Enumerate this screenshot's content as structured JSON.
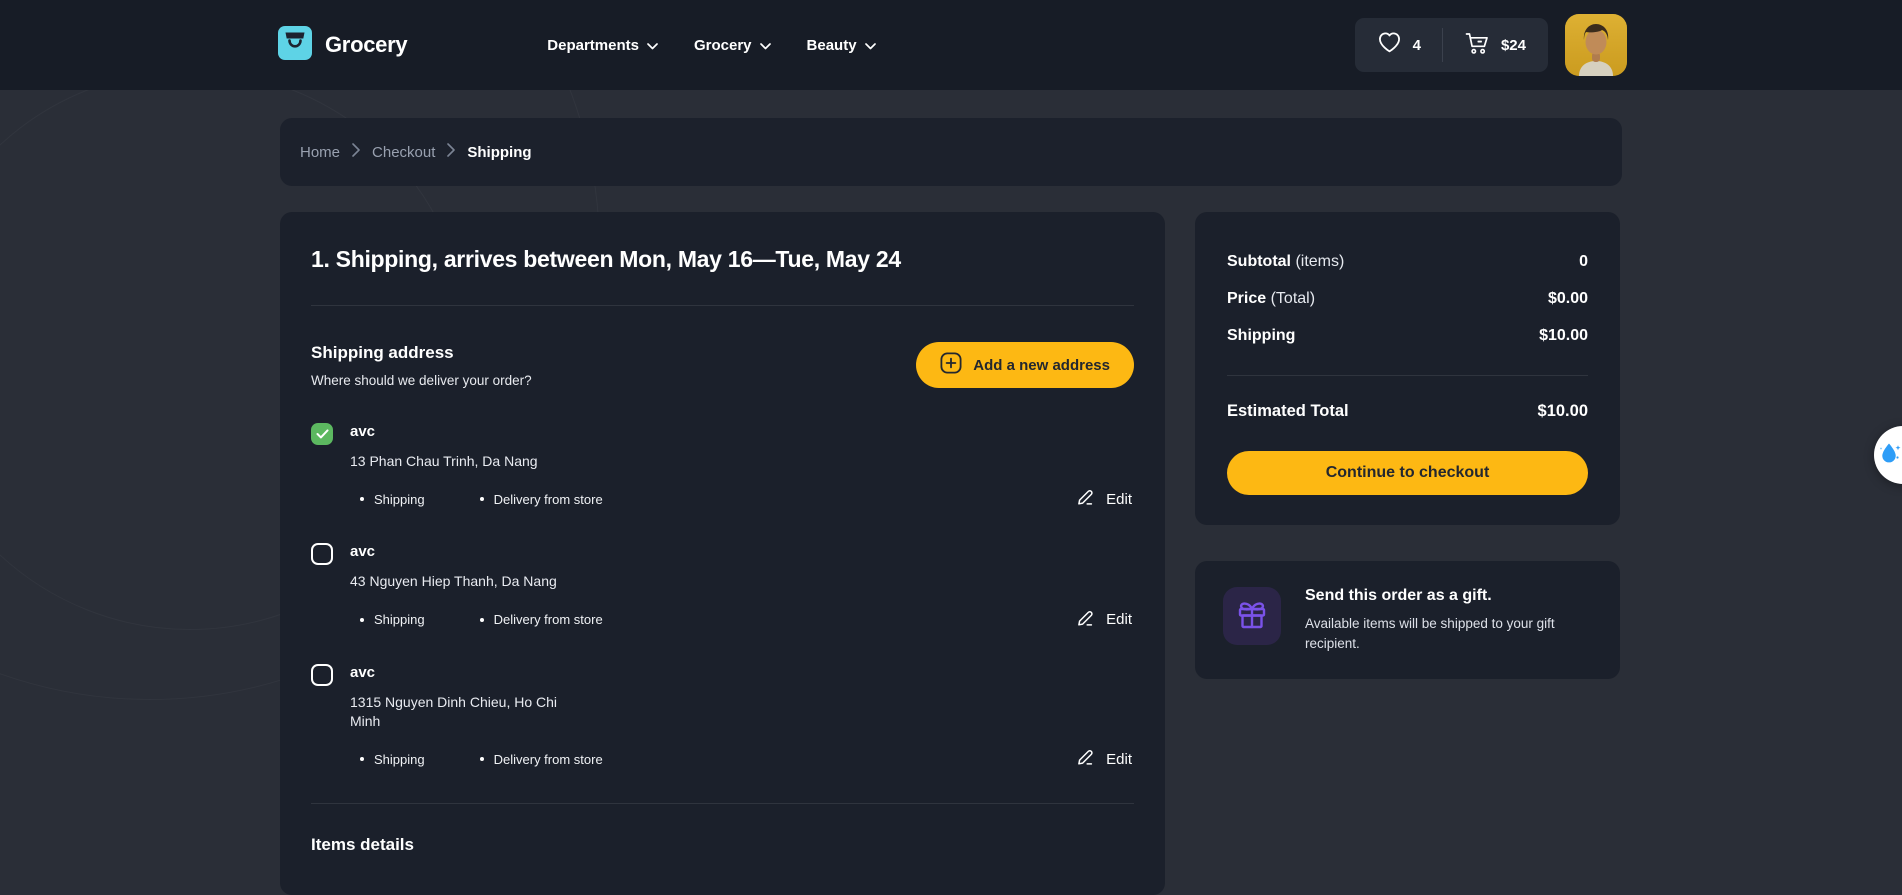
{
  "header": {
    "brand": "Grocery",
    "nav_items": [
      {
        "label": "Departments"
      },
      {
        "label": "Grocery"
      },
      {
        "label": "Beauty"
      }
    ],
    "wishlist": {
      "count": "4"
    },
    "cart": {
      "total": "$24"
    }
  },
  "breadcrumb": {
    "items": [
      "Home",
      "Checkout"
    ],
    "current": "Shipping"
  },
  "shipping_section": {
    "title": "1. Shipping, arrives between Mon, May 16—Tue, May 24",
    "address_header": {
      "title": "Shipping address",
      "subtitle": "Where should we deliver your order?",
      "add_button_label": "Add a new address"
    },
    "addresses": [
      {
        "name": "avc",
        "address": "13 Phan Chau Trinh, Da Nang",
        "selected": true,
        "tags": [
          "Shipping",
          "Delivery from store"
        ],
        "edit_label": "Edit"
      },
      {
        "name": "avc",
        "address": "43 Nguyen Hiep Thanh, Da Nang",
        "selected": false,
        "tags": [
          "Shipping",
          "Delivery from store"
        ],
        "edit_label": "Edit"
      },
      {
        "name": "avc",
        "address": "1315 Nguyen Dinh Chieu, Ho Chi Minh",
        "selected": false,
        "tags": [
          "Shipping",
          "Delivery from store"
        ],
        "edit_label": "Edit"
      }
    ],
    "items_details_title": "Items details"
  },
  "order_summary": {
    "rows": [
      {
        "label": "Subtotal",
        "suffix": "(items)",
        "value": "0"
      },
      {
        "label": "Price",
        "suffix": "(Total)",
        "value": "$0.00"
      },
      {
        "label": "Shipping",
        "suffix": "",
        "value": "$10.00"
      }
    ],
    "estimated_total": {
      "label": "Estimated Total",
      "value": "$10.00"
    },
    "checkout_button_label": "Continue to checkout"
  },
  "gift_banner": {
    "title": "Send this order as a gift.",
    "description": "Available items will be shipped to your gift recipient."
  },
  "icons": {
    "brand": "shopping-bag-icon",
    "nav": "chevron-down-icon",
    "wishlist": "heart-icon",
    "cart": "cart-icon",
    "breadcrumb_separator": "chevron-right-icon",
    "add_address": "plus-square-icon",
    "selected_address": "checkmark-icon",
    "edit": "pencil-icon",
    "gift": "gift-icon",
    "floating": "water-drop-icon"
  },
  "colors": {
    "accent": "#fdb813",
    "brand": "#5ed3e6",
    "checkbox_checked": "#5cb860",
    "gift_icon": "#7a52e8",
    "widget_droplet": "#2e9df7",
    "navbar_bg": "#171c26",
    "page_bg": "#2a2e37",
    "card_bg": "#1b202b"
  }
}
